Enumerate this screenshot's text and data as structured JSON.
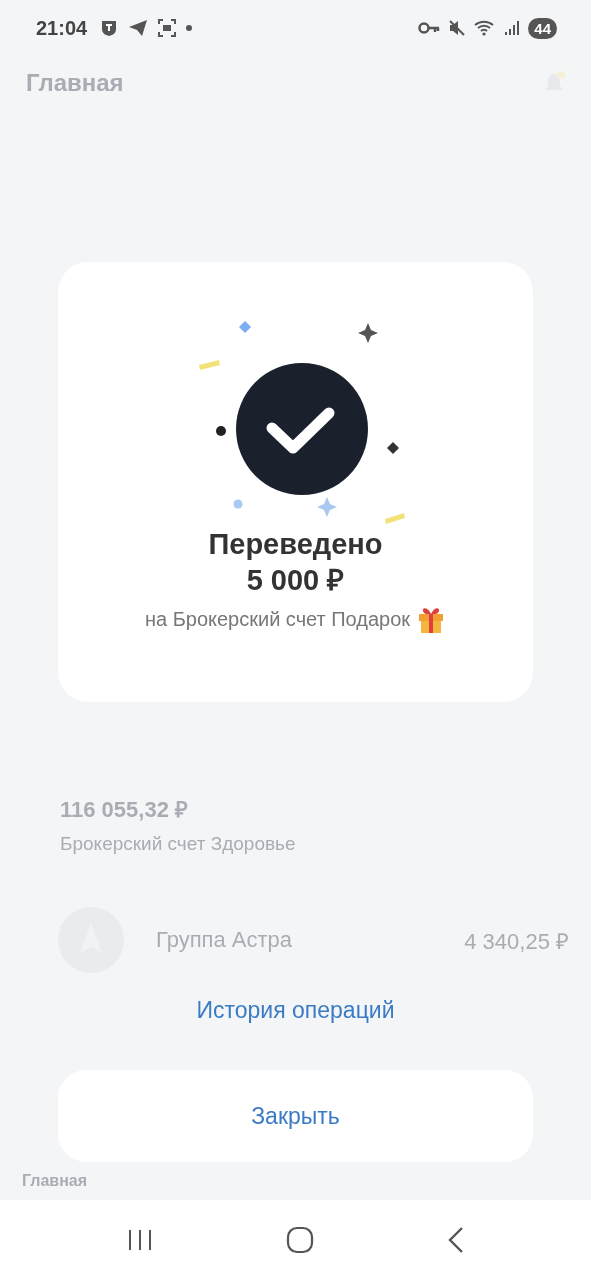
{
  "status_bar": {
    "time": "21:04",
    "battery": "44"
  },
  "background": {
    "title": "Главная",
    "account": {
      "amount": "116 055,32 ₽",
      "name": "Брокерский счет Здоровье"
    },
    "asset": {
      "name": "Группа Астра",
      "value": "4 340,25 ₽"
    },
    "tab_label": "Главная"
  },
  "dialog": {
    "title": "Переведено",
    "amount": "5 000 ₽",
    "subtitle": "на Брокерский счет Подарок",
    "history_link": "История операций",
    "close_button": "Закрыть"
  }
}
